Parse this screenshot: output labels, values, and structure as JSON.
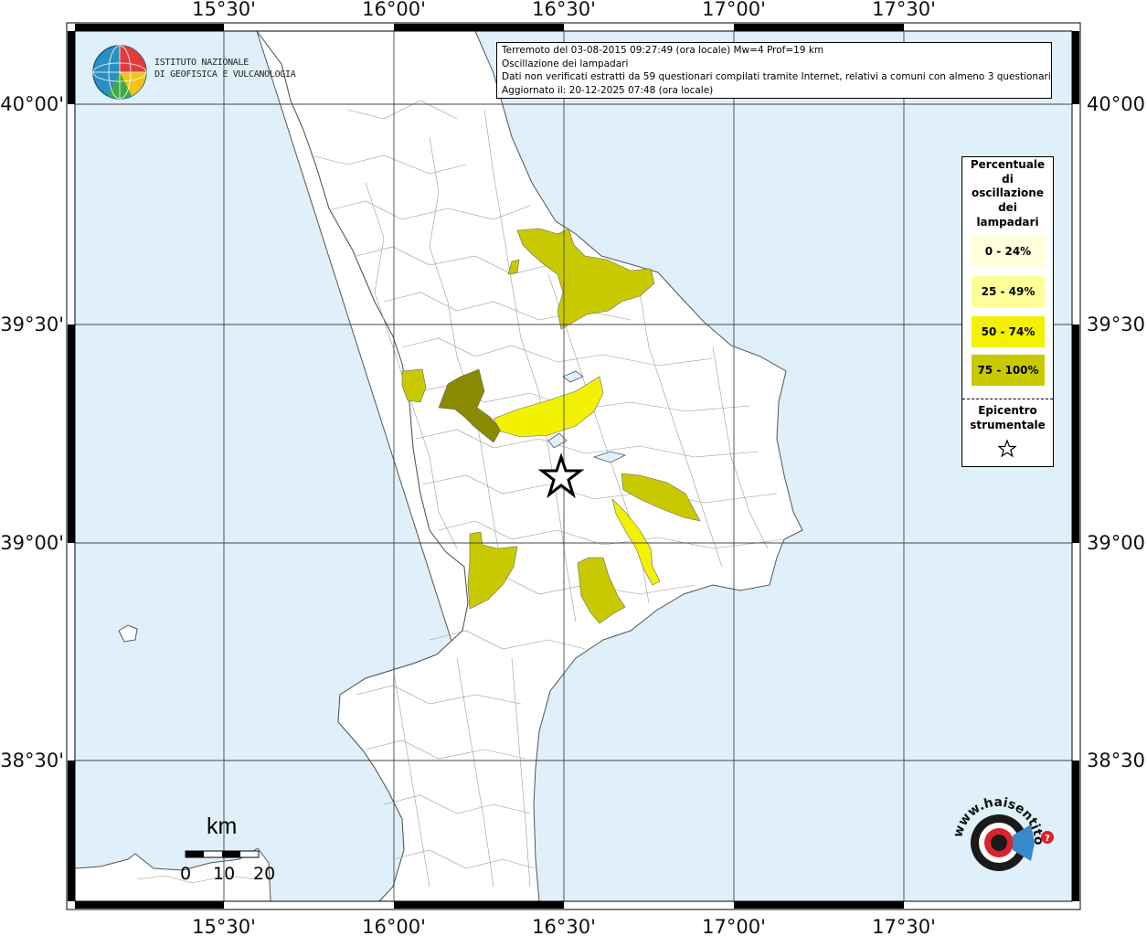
{
  "map": {
    "info": {
      "line1": "Terremoto del 03-08-2015 09:27:49 (ora locale) Mw=4 Prof=19 km",
      "line2": "Oscillazione dei lampadari",
      "line3": "Dati non verificati estratti da 59 questionari compilati tramite Internet, relativi a comuni con almeno 3 questionari.",
      "line4": "Aggiornato il: 20-12-2025 07:48 (ora locale)"
    },
    "lon_ticks": [
      "15°30'",
      "16°00'",
      "16°30'",
      "17°00'",
      "17°30'"
    ],
    "lat_ticks": [
      "40°00'",
      "39°30'",
      "39°00'",
      "38°30'"
    ],
    "legend": {
      "title": "Percentuale di oscillazione dei lampadari",
      "entries": [
        {
          "label": "0 - 24%",
          "color": "#ffffdc"
        },
        {
          "label": "25 - 49%",
          "color": "#ffff9a"
        },
        {
          "label": "50 - 74%",
          "color": "#f2f200"
        },
        {
          "label": "75 - 100%",
          "color": "#c9c900"
        }
      ],
      "epicentre_label": "Epicentro strumentale"
    },
    "scale": {
      "unit": "km",
      "labels": [
        "0",
        "10",
        "20"
      ]
    },
    "logo_ingv": {
      "line1": "ISTITUTO NAZIONALE",
      "line2": "DI GEOFISICA E VULCANOLOGIA"
    },
    "logo_hst": {
      "text": "www.haisentitoilterremoto.it"
    },
    "colors": {
      "sea": "#dff0fb",
      "land": "#ffffff",
      "dark_class": "#8a8a00",
      "mid_class": "#cccc00",
      "bright_class": "#eeee00"
    }
  }
}
